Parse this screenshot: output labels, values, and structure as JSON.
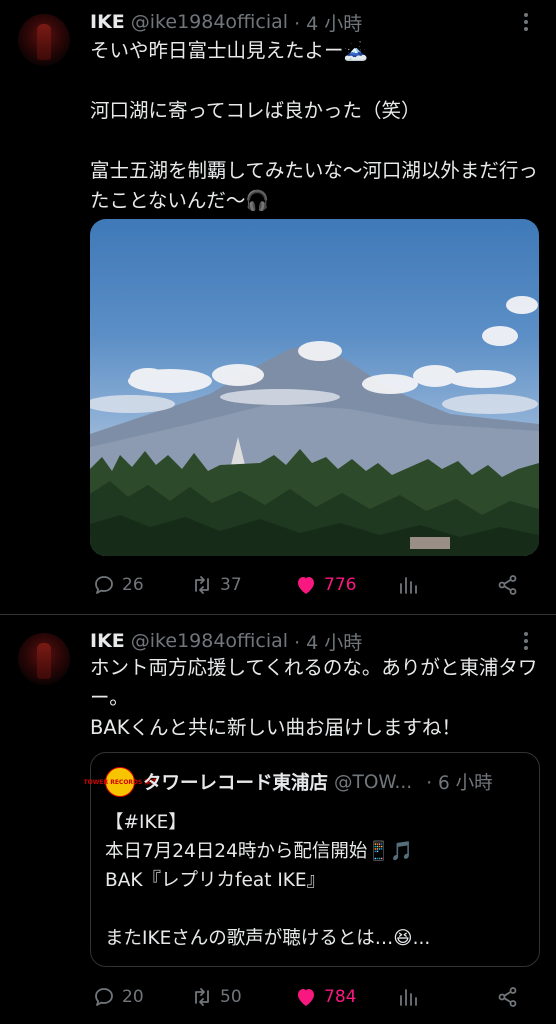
{
  "tweet1": {
    "name": "IKE",
    "handle": "@ike1984official",
    "time": "· 4 小時",
    "text": "そいや昨日富士山見えたよー🗻\n\n河口湖に寄ってコレば良かった（笑）\n\n富士五湖を制覇してみたいな〜河口湖以外まだ行ったことないんだ〜🎧",
    "replies": "26",
    "retweets": "37",
    "likes": "776"
  },
  "tweet2": {
    "name": "IKE",
    "handle": "@ike1984official",
    "time": "· 4 小時",
    "text": "ホント両方応援してくれるのな。ありがと東浦タワー。\nBAKくんと共に新しい曲お届けしますね！",
    "replies": "20",
    "retweets": "50",
    "likes": "784",
    "quote": {
      "avatar_text": "TOWER RECORDS 東浦",
      "name": "タワーレコード東浦店",
      "handle": "@TOW...",
      "time": "· 6 小時",
      "text": "【#IKE】\n本日7月24日24時から配信開始📱🎵\nBAK『レプリカfeat IKE』\n\nまたIKEさんの歌声が聴けるとは…😆..."
    }
  },
  "colors": {
    "background": "#000000",
    "text": "#e7e9ea",
    "muted": "#71767b",
    "like": "#f91880",
    "divider": "#2f3336"
  },
  "icons": [
    "more-icon",
    "reply-icon",
    "retweet-icon",
    "heart-icon",
    "views-icon",
    "share-icon"
  ]
}
